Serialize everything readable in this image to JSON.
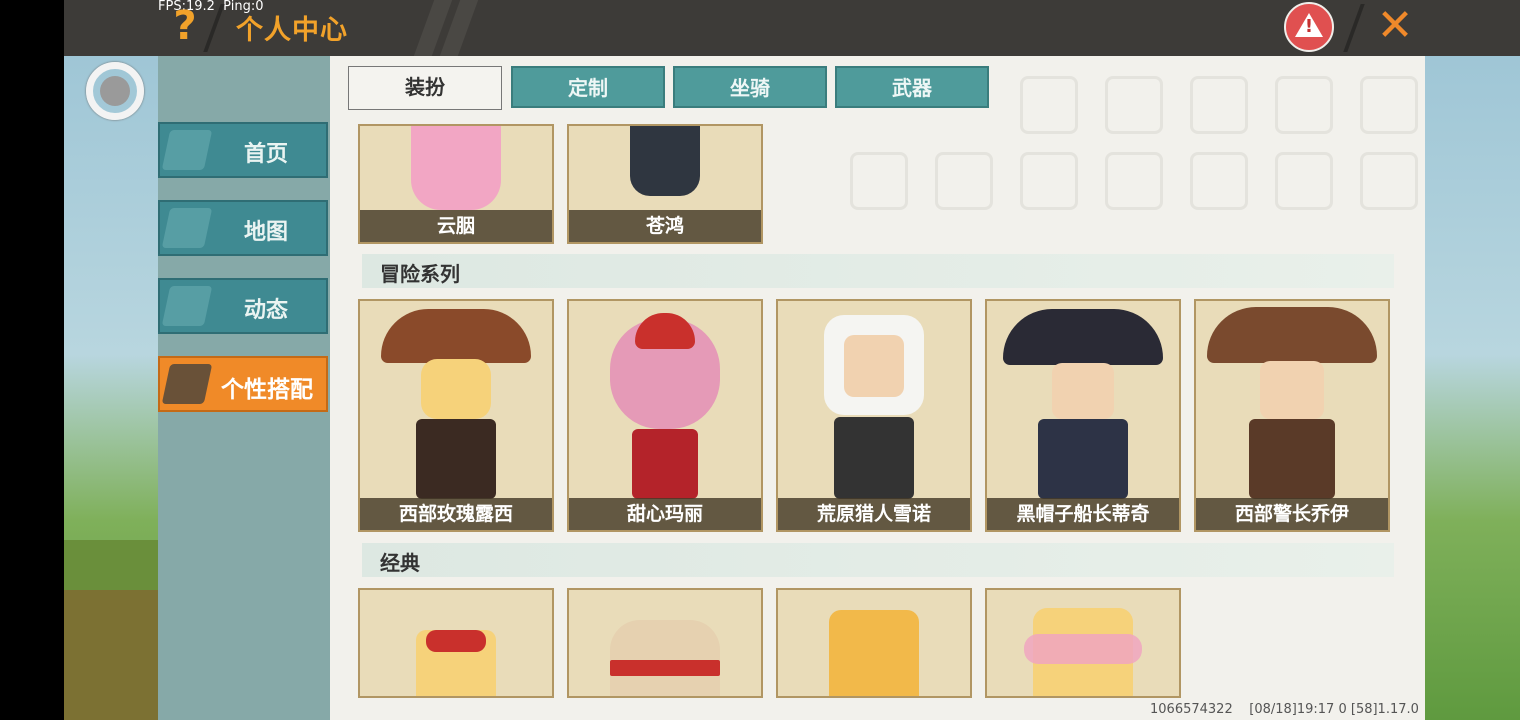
{
  "status": {
    "fps": "FPS:19.2",
    "ping": "Ping:0"
  },
  "header": {
    "help_icon": "?",
    "title": "个人中心",
    "close_icon": "✕"
  },
  "sidebar": {
    "items": [
      {
        "label": "首页",
        "icon": "home-icon"
      },
      {
        "label": "地图",
        "icon": "map-icon"
      },
      {
        "label": "动态",
        "icon": "bell-icon"
      },
      {
        "label": "个性搭配",
        "icon": "outfit-icon",
        "active": true
      }
    ]
  },
  "tabs": [
    {
      "label": "装扮",
      "active": true
    },
    {
      "label": "定制"
    },
    {
      "label": "坐骑"
    },
    {
      "label": "武器"
    }
  ],
  "top_cards": [
    {
      "name": "云胭"
    },
    {
      "name": "苍鸿"
    }
  ],
  "sections": {
    "adventure": "冒险系列",
    "classic": "经典"
  },
  "adventure_cards": [
    {
      "name": "西部玫瑰露西"
    },
    {
      "name": "甜心玛丽"
    },
    {
      "name": "荒原猎人雪诺"
    },
    {
      "name": "黑帽子船长蒂奇"
    },
    {
      "name": "西部警长乔伊"
    }
  ],
  "footer": {
    "id": "1066574322",
    "time": "[08/18]19:17 0",
    "version": "[58]1.17.0"
  },
  "colors": {
    "accent": "#f2a22a",
    "nav": "#3f8a92",
    "active_nav": "#f08a28",
    "tab": "#4f9b9b"
  }
}
